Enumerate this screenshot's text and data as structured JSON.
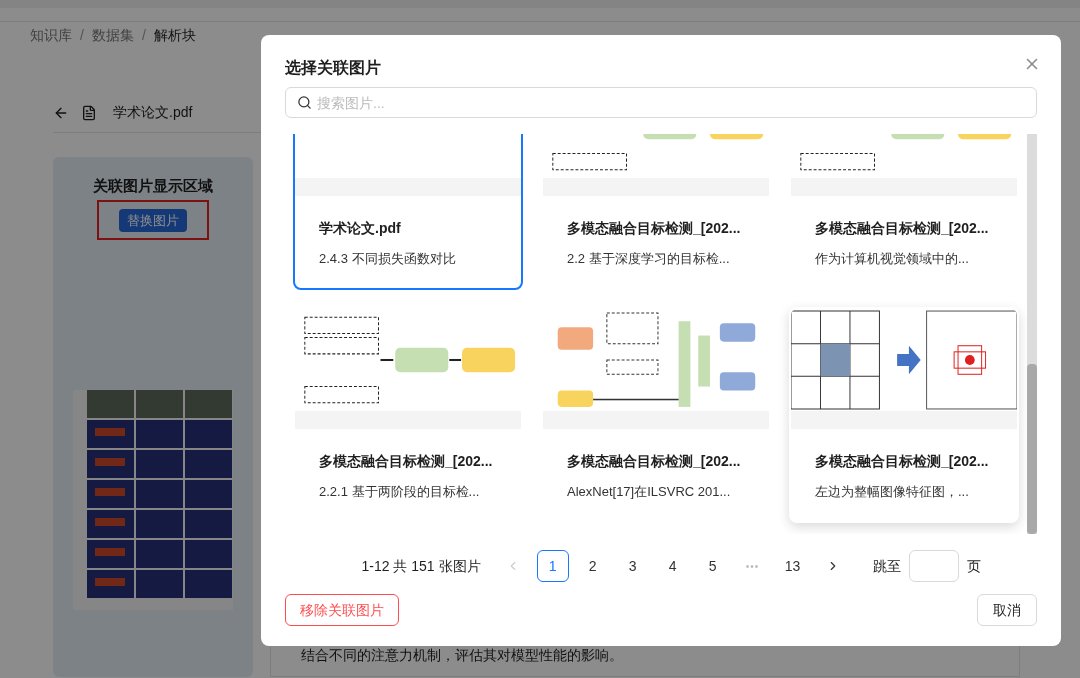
{
  "breadcrumb": [
    {
      "kind": "link",
      "label": "知识库",
      "current": false
    },
    {
      "kind": "separator",
      "label": "/",
      "current": false
    },
    {
      "kind": "link",
      "label": "数据集",
      "current": false
    },
    {
      "kind": "separator",
      "label": "/",
      "current": false
    },
    {
      "kind": "link",
      "label": "解析块",
      "current": true
    }
  ],
  "file_name": "学术论文.pdf",
  "panel": {
    "title": "关联图片显示区域",
    "replace_button": "替换图片"
  },
  "paragraph": "结合不同的注意力机制，评估其对模型性能的影响。",
  "modal": {
    "title": "选择关联图片",
    "search": {
      "placeholder": "搜索图片..."
    },
    "cards": [
      {
        "title": "学术论文.pdf",
        "subtitle": "2.4.3 不同损失函数对比",
        "selected": true,
        "hovered": false
      },
      {
        "title": "多模态融合目标检测_[202...",
        "subtitle": "2.2 基于深度学习的目标检...",
        "selected": false,
        "hovered": false
      },
      {
        "title": "多模态融合目标检测_[202...",
        "subtitle": "作为计算机视觉领域中的...",
        "selected": false,
        "hovered": false
      },
      {
        "title": "多模态融合目标检测_[202...",
        "subtitle": "2.2.1 基于两阶段的目标检...",
        "selected": false,
        "hovered": false
      },
      {
        "title": "多模态融合目标检测_[202...",
        "subtitle": "AlexNet[17]在ILSVRC 201...",
        "selected": false,
        "hovered": false
      },
      {
        "title": "多模态融合目标检测_[202...",
        "subtitle": "左边为整幅图像特征图，...",
        "selected": false,
        "hovered": true
      }
    ],
    "pagination": {
      "summary": "1-12 共 151 张图片",
      "prev": {
        "disabled": true
      },
      "next": {
        "disabled": false
      },
      "pages": [
        {
          "label": "1",
          "kind": "page",
          "selected": true
        },
        {
          "label": "2",
          "kind": "page",
          "selected": false
        },
        {
          "label": "3",
          "kind": "page",
          "selected": false
        },
        {
          "label": "4",
          "kind": "page",
          "selected": false
        },
        {
          "label": "5",
          "kind": "page",
          "selected": false
        },
        {
          "label": "•••",
          "kind": "ellipsis"
        },
        {
          "label": "13",
          "kind": "page",
          "selected": false
        }
      ],
      "jump_label": "跳至",
      "jump_suffix": "页"
    },
    "remove_button": "移除关联图片",
    "cancel_button": "取消"
  }
}
